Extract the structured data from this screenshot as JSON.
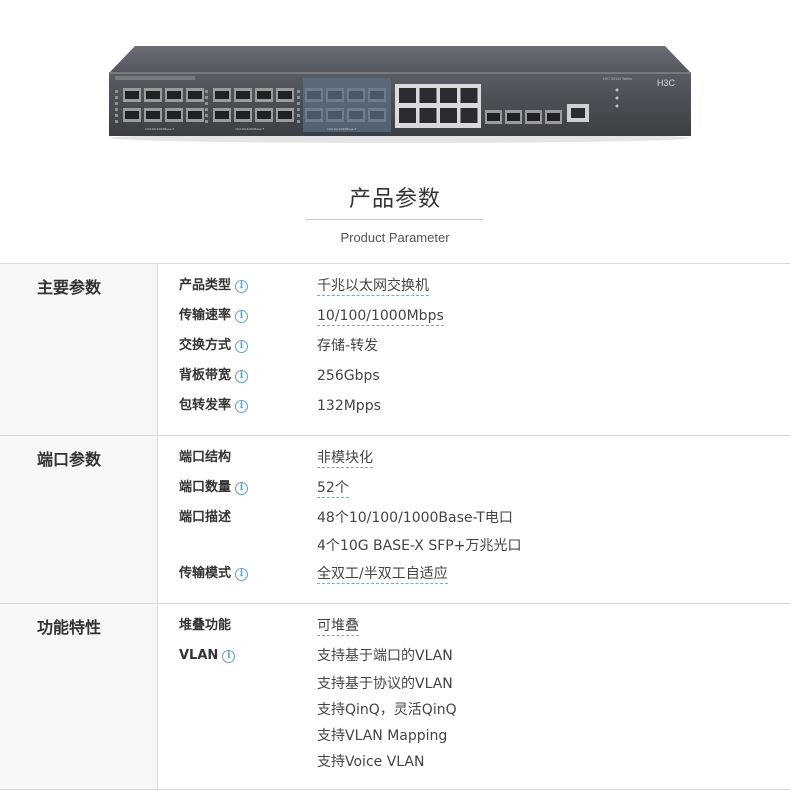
{
  "product_image": {
    "brand": "H3C",
    "series": "H3C S5130 Series",
    "port_group_labels": [
      "10/100/1000Base-T",
      "10/100/1000Base-T",
      "10/100/1000Base-T"
    ]
  },
  "heading": {
    "title": "产品参数",
    "subtitle": "Product Parameter"
  },
  "sections": [
    {
      "label": "主要参数",
      "rows": [
        {
          "label": "产品类型",
          "info": true,
          "values": [
            "千兆以太网交换机"
          ],
          "dashed": true
        },
        {
          "label": "传输速率",
          "info": true,
          "values": [
            "10/100/1000Mbps"
          ],
          "dashed": true
        },
        {
          "label": "交换方式",
          "info": true,
          "values": [
            "存储-转发"
          ],
          "dashed": false
        },
        {
          "label": "背板带宽",
          "info": true,
          "values": [
            "256Gbps"
          ],
          "dashed": false
        },
        {
          "label": "包转发率",
          "info": true,
          "values": [
            "132Mpps"
          ],
          "dashed": false
        }
      ]
    },
    {
      "label": "端口参数",
      "rows": [
        {
          "label": "端口结构",
          "info": false,
          "values": [
            "非模块化"
          ],
          "dashed": true
        },
        {
          "label": "端口数量",
          "info": true,
          "values": [
            "52个"
          ],
          "dashed": true
        },
        {
          "label": "端口描述",
          "info": false,
          "values": [
            "48个10/100/1000Base-T电口",
            "4个10G BASE-X SFP+万兆光口"
          ],
          "dashed": false
        },
        {
          "label": "传输模式",
          "info": true,
          "values": [
            "全双工/半双工自适应"
          ],
          "dashed": true
        }
      ]
    },
    {
      "label": "功能特性",
      "rows": [
        {
          "label": "堆叠功能",
          "info": false,
          "values": [
            "可堆叠"
          ],
          "dashed": true
        },
        {
          "label": "VLAN",
          "info": true,
          "values": [
            "支持基于端口的VLAN",
            "支持基于协议的VLAN",
            "支持QinQ，灵活QinQ",
            "支持VLAN Mapping",
            "支持Voice VLAN"
          ],
          "dashed": false
        }
      ]
    }
  ],
  "info_icon_glyph": "i",
  "colors": {
    "label_bg": "#f7f7f7",
    "border": "#d8d8d8",
    "info_icon": "#5aa0d8",
    "dashed_underline": "#7fa7c9"
  }
}
